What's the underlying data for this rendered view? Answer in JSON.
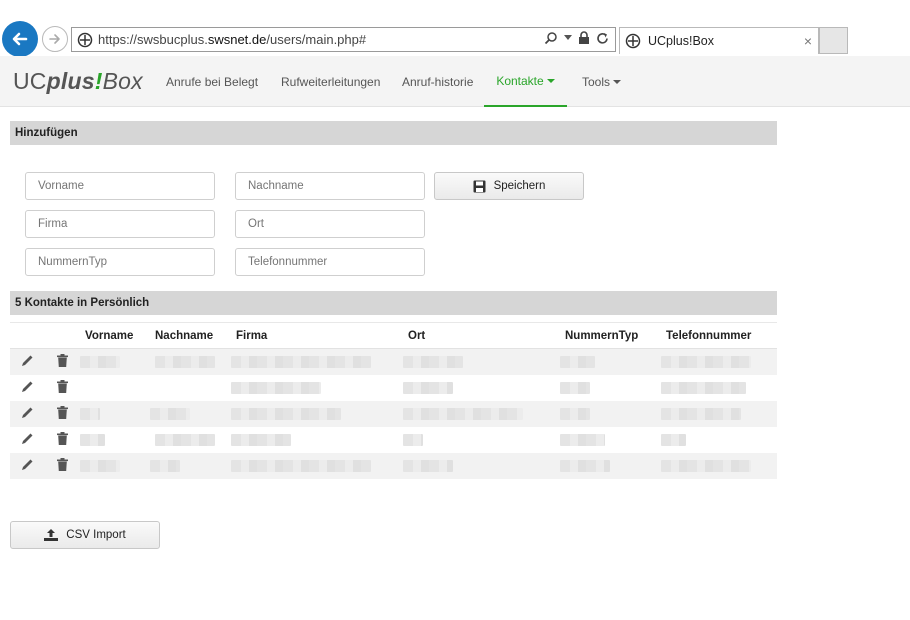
{
  "browser": {
    "url_prefix": "https://swsbucplus.",
    "url_host": "swsnet.de",
    "url_path": "/users/main.php#",
    "tab_title": "UCplus!Box",
    "tab_close": "×"
  },
  "brand": {
    "uc": "UC",
    "plus": "plus",
    "bang": "!",
    "box": "Box"
  },
  "nav": {
    "items": [
      {
        "label": "Anrufe bei Belegt",
        "active": false
      },
      {
        "label": "Rufweiterleitungen",
        "active": false
      },
      {
        "label": "Anruf-historie",
        "active": false
      },
      {
        "label": "Kontakte",
        "active": true,
        "dropdown": true
      },
      {
        "label": "Tools",
        "active": false,
        "dropdown": true
      }
    ]
  },
  "add_section": {
    "title": "Hinzufügen",
    "placeholders": {
      "vorname": "Vorname",
      "nachname": "Nachname",
      "firma": "Firma",
      "ort": "Ort",
      "nummerntyp": "NummernTyp",
      "telefonnummer": "Telefonnummer"
    },
    "save_label": "Speichern"
  },
  "list_section": {
    "title": "5 Kontakte in Persönlich",
    "columns": [
      "Vorname",
      "Nachname",
      "Firma",
      "Ort",
      "NummernTyp",
      "Telefonnummer"
    ],
    "row_count": 5
  },
  "csv_import_label": "CSV Import",
  "colors": {
    "accent": "#2aa52a",
    "back_button": "#1a78c2",
    "section_header": "#d6d6d6"
  }
}
